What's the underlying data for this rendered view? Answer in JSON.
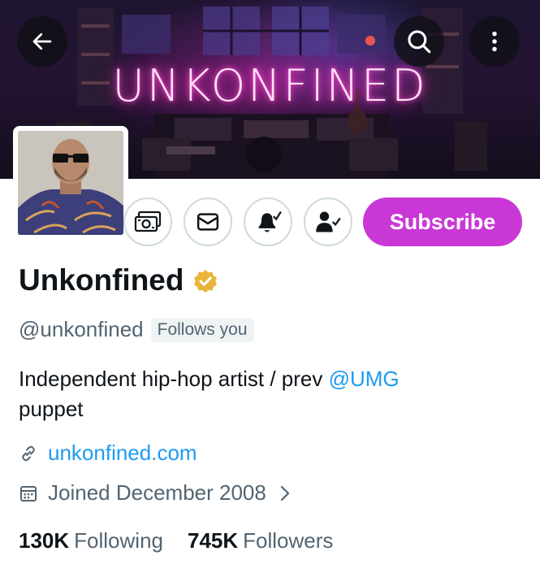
{
  "banner": {
    "logo_text": "UNKONFINED",
    "accent_neon": "#ff3cc8"
  },
  "header": {
    "back_icon": "arrow-left-icon",
    "search_icon": "search-icon",
    "more_icon": "more-vertical-icon"
  },
  "profile": {
    "display_name": "Unkonfined",
    "verified_badge_color": "#e8b43a",
    "handle": "@unkonfined",
    "follows_you_label": "Follows you",
    "bio_text": "Independent hip-hop artist / prev ",
    "bio_mention": "@UMG",
    "bio_text_end": "puppet",
    "website": "unkonfined.com",
    "joined": "Joined December 2008",
    "following_count": "130K",
    "following_label": "Following",
    "followers_count": "745K",
    "followers_label": "Followers"
  },
  "actions": {
    "tip_icon": "money-icon",
    "message_icon": "mail-icon",
    "notify_icon": "bell-check-icon",
    "follow_icon": "user-check-icon",
    "subscribe_label": "Subscribe",
    "subscribe_color": "#c938d6"
  }
}
